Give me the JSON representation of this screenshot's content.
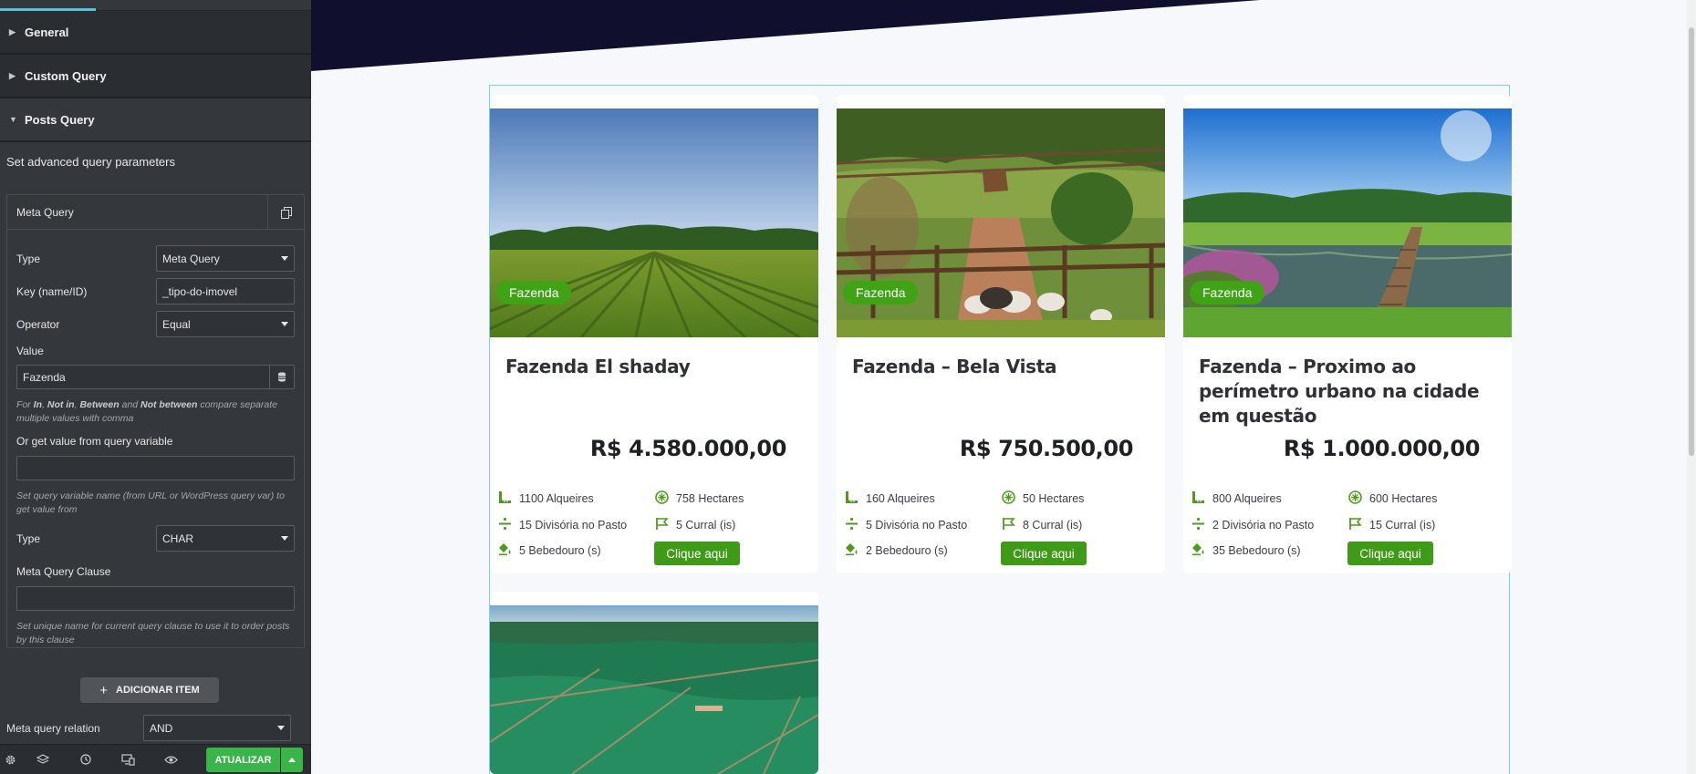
{
  "panel": {
    "sections": [
      {
        "label": "General",
        "open": false
      },
      {
        "label": "Custom Query",
        "open": false
      },
      {
        "label": "Posts Query",
        "open": true
      }
    ],
    "posts_query_description": "Set advanced query parameters",
    "repeater": {
      "title": "Meta Query",
      "type_label": "Type",
      "type_value": "Meta Query",
      "key_label": "Key (name/ID)",
      "key_value": "_tipo-do-imovel",
      "operator_label": "Operator",
      "operator_value": "Equal",
      "value_label": "Value",
      "value_value": "Fazenda",
      "value_note_1": "For ",
      "value_note_in": "In",
      "value_note_c1": ", ",
      "value_note_notin": "Not in",
      "value_note_c2": ", ",
      "value_note_between": "Between",
      "value_note_and": " and ",
      "value_note_notbetween": "Not between",
      "value_note_2": " compare separate multiple values with comma",
      "query_var_label": "Or get value from query variable",
      "query_var_value": "",
      "query_var_note": "Set query variable name (from URL or WordPress query var) to get value from",
      "type2_label": "Type",
      "type2_value": "CHAR",
      "clause_label": "Meta Query Clause",
      "clause_value": "",
      "clause_note": "Set unique name for current query clause to use it to order posts by this clause"
    },
    "add_item_label": "ADICIONAR ITEM",
    "relation_label": "Meta query relation",
    "relation_value": "AND",
    "footer": {
      "icons": [
        "settings-icon",
        "layers-icon",
        "history-icon",
        "responsive-icon",
        "preview-eye-icon"
      ],
      "update_label": "ATUALIZAR"
    }
  },
  "colors": {
    "panel_bg": "#34383c",
    "accent_green": "#39b54a",
    "badge_green": "#40a316",
    "banner_navy": "#100f2e",
    "frame_blue": "#7ad0e6"
  },
  "listings": [
    {
      "badge": "Fazenda",
      "title": "Fazenda El shaday",
      "price": "R$ 4.580.000,00",
      "alqueires": "1100 Alqueires",
      "hectares": "758 Hectares",
      "divisoria": "15 Divisória no Pasto",
      "curral": "5 Curral (is)",
      "bebedouro": "5 Bebedouro (s)",
      "cta": "Clique aqui",
      "image": "crop-field-image"
    },
    {
      "badge": "Fazenda",
      "title": "Fazenda – Bela Vista",
      "price": "R$ 750.500,00",
      "alqueires": "160 Alqueires",
      "hectares": "50 Hectares",
      "divisoria": "5 Divisória no Pasto",
      "curral": "8 Curral (is)",
      "bebedouro": "2 Bebedouro (s)",
      "cta": "Clique aqui",
      "image": "ranch-animals-image"
    },
    {
      "badge": "Fazenda",
      "title": "Fazenda – Proximo ao perímetro urbano na cidade em questão",
      "price": "R$ 1.000.000,00",
      "alqueires": "800 Alqueires",
      "hectares": "600 Hectares",
      "divisoria": "2 Divisória no Pasto",
      "curral": "15 Curral (is)",
      "bebedouro": "35 Bebedouro (s)",
      "cta": "Clique aqui",
      "image": "lake-bridge-image"
    }
  ],
  "partial_card": {
    "image": "aerial-farm-image"
  }
}
